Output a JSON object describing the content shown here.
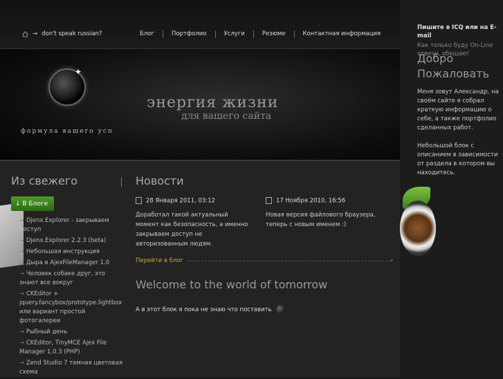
{
  "header": {
    "crumb": "don't speak russian?",
    "nav": [
      "Блог",
      "Портфолио",
      "Услуги",
      "Резюме",
      "Контактная информация"
    ]
  },
  "banner": {
    "line1": "энергия жизни",
    "line2": "для вашего сайта",
    "slogan": "формула вашего усп"
  },
  "left": {
    "heading": "Из свежего",
    "blog_button": "↓ В Блоге",
    "items": [
      "Djenx.Explorer - закрываем доступ",
      "Djenx.Explorer 2.2.3 (beta)",
      "Небольшая инструкция",
      "Дыра в AjexFileManager 1.0",
      "Человек собаке друг, это знают все вокруг",
      "CKEditor + jquery.fancybox/prototype.lightbox или вариант простой фотогалереи",
      "Рыбный день",
      "CKEditor, TinyMCE Ajex File Manager 1.0.3 (PHP)",
      "Zend Studio 7 темная цветовая схема"
    ]
  },
  "news": {
    "heading": "Новости",
    "items": [
      {
        "date": "28 Января 2011, 03:12",
        "text": "Доработал такой актуальный момент как безопасность, а именно закрываем доступ не авторизованным людям."
      },
      {
        "date": "17 Ноября 2010, 16:56",
        "text": "Новая версия файлового браузера, теперь с новым именем :)"
      }
    ],
    "more": "Перейти в блог"
  },
  "welcome": {
    "title": "Welcome to the world of tomorrow",
    "text": "А в этот блок я пока не знаю что поставить"
  },
  "sidebar": {
    "icq_line": "Пишите в ICQ или на E-mail",
    "icq_note": "Как только буду On-Line отвечу, обещаю!",
    "hello": "Добро Пожаловать",
    "intro": "Меня зовут Александр, на своём сайте я собрал краткую информацию о себе, а также портфолио сделанных работ.",
    "intro2": "Небольшой блок с описанием в зависимости от раздела в котором вы находитесь."
  }
}
